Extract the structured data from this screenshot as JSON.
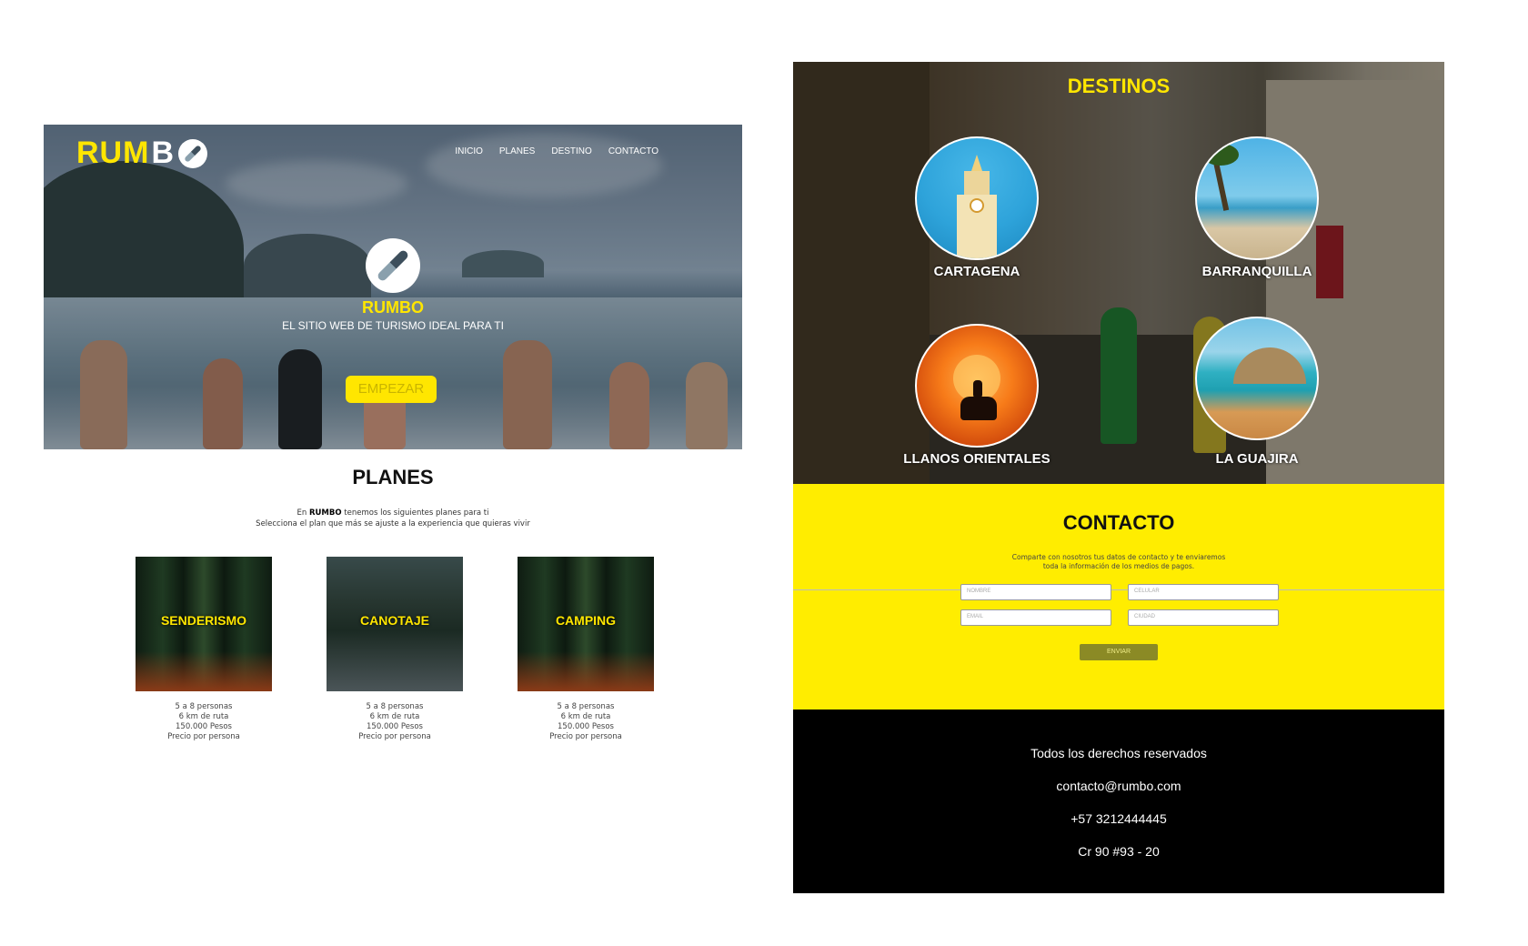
{
  "left_page": {
    "brand": {
      "part1": "RUM",
      "part2": "B",
      "icon": "compass-icon"
    },
    "nav": {
      "items": [
        {
          "label": "INICIO"
        },
        {
          "label": "PLANES"
        },
        {
          "label": "DESTINO"
        },
        {
          "label": "CONTACTO"
        }
      ]
    },
    "hero": {
      "icon": "compass-icon",
      "title": "RUMBO",
      "subtitle": "EL SITIO WEB DE TURISMO IDEAL PARA TI",
      "button_label": "EMPEZAR"
    },
    "planes": {
      "title": "PLANES",
      "intro_prefix": "En ",
      "intro_brand": "RUMBO",
      "intro_suffix": " tenemos los siguientes planes para ti",
      "intro_line2": "Selecciona el plan que más se ajuste a la experiencia que quieras vivir",
      "items": [
        {
          "name": "SENDERISMO",
          "people": "5 a 8 personas",
          "route": "6 km de ruta",
          "price": "150.000 Pesos",
          "note": "Precio por persona"
        },
        {
          "name": "CANOTAJE",
          "people": "5 a 8 personas",
          "route": "6 km de ruta",
          "price": "150.000 Pesos",
          "note": "Precio por persona"
        },
        {
          "name": "CAMPING",
          "people": "5 a 8 personas",
          "route": "6 km de ruta",
          "price": "150.000 Pesos",
          "note": "Precio por persona"
        }
      ]
    }
  },
  "right_page": {
    "destinos": {
      "title": "DESTINOS",
      "items": [
        {
          "name": "CARTAGENA"
        },
        {
          "name": "BARRANQUILLA"
        },
        {
          "name": "LLANOS ORIENTALES"
        },
        {
          "name": "LA GUAJIRA"
        }
      ]
    },
    "contacto": {
      "title": "CONTACTO",
      "intro_line1": "Comparte con nosotros tus datos de contacto y te enviaremos",
      "intro_line2": "toda la información de los medios de pagos.",
      "fields": {
        "nombre_placeholder": "NOMBRE",
        "celular_placeholder": "CELULAR",
        "email_placeholder": "EMAIL",
        "ciudad_placeholder": "CIUDAD"
      },
      "send_label": "ENVIAR"
    },
    "footer": {
      "rights": "Todos los derechos reservados",
      "email": "contacto@rumbo.com",
      "phone": "+57 3212444445",
      "address": "Cr 90 #93 - 20"
    }
  },
  "colors": {
    "accent_yellow": "#ffe600",
    "contact_bg": "#ffed00",
    "footer_bg": "#000000",
    "send_button": "#8b8a25"
  }
}
